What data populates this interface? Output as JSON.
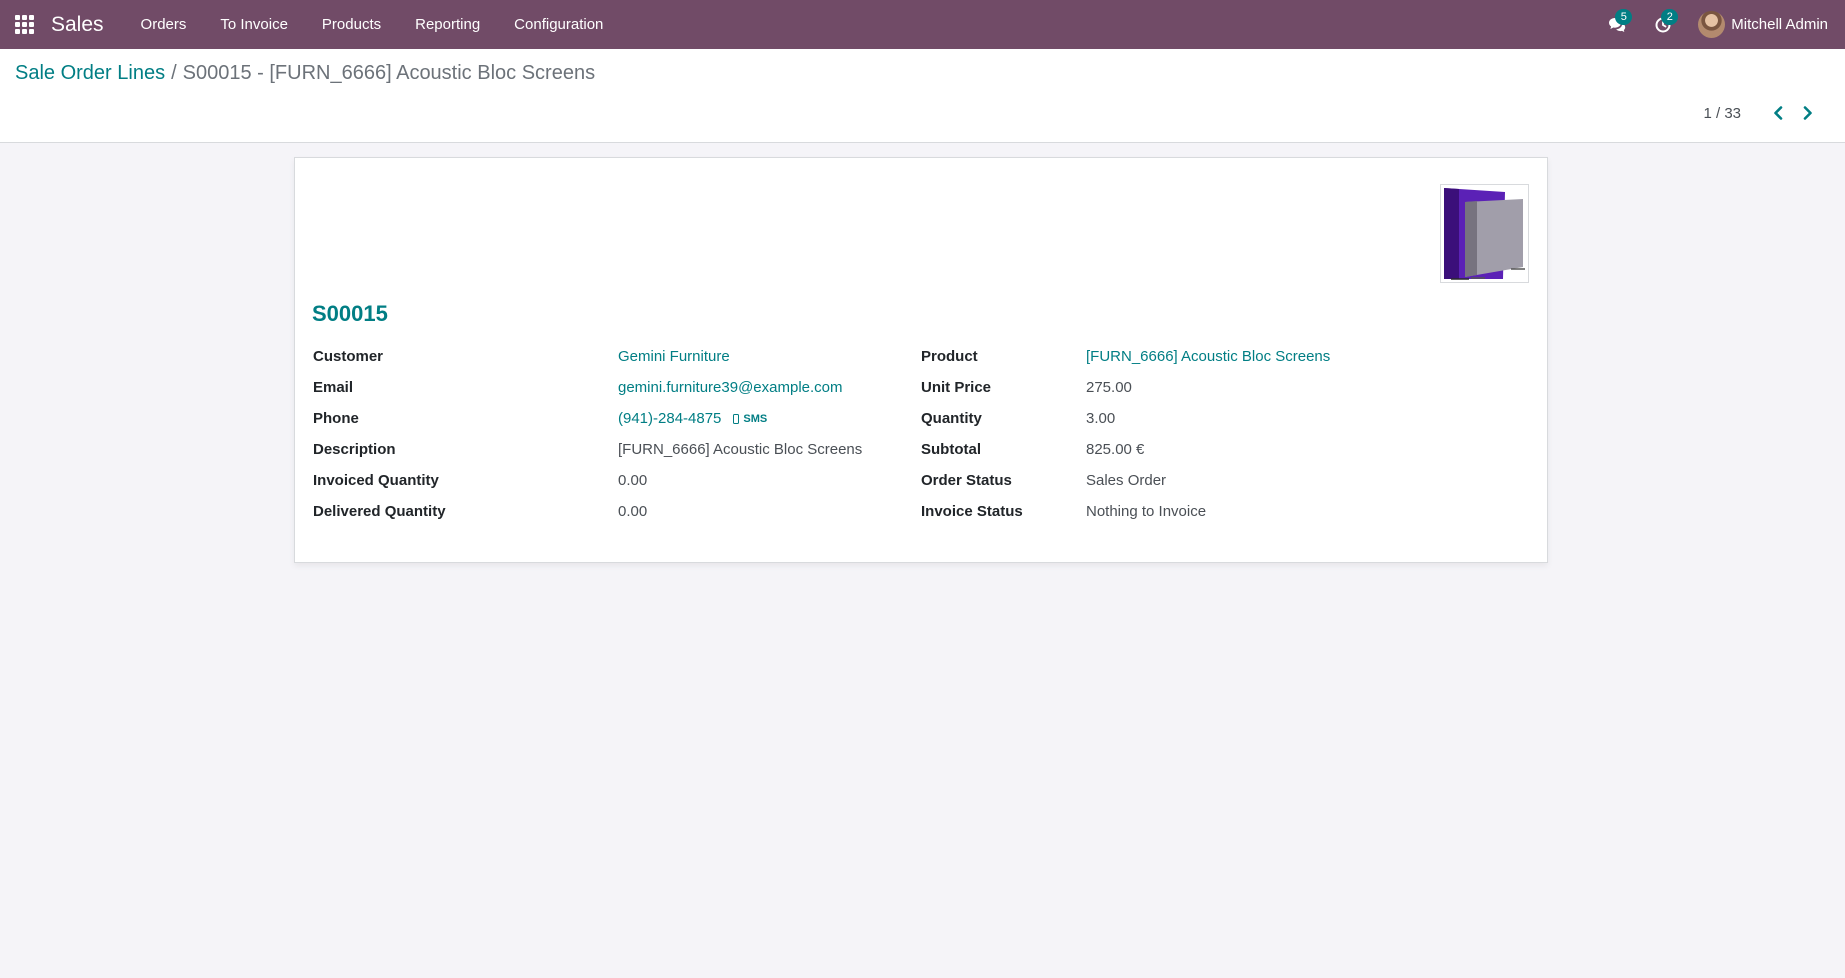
{
  "navbar": {
    "app_name": "Sales",
    "menu": [
      "Orders",
      "To Invoice",
      "Products",
      "Reporting",
      "Configuration"
    ],
    "messages_count": "5",
    "activities_count": "2",
    "user_name": "Mitchell Admin"
  },
  "breadcrumb": {
    "parent": "Sale Order Lines",
    "separator": "/",
    "current": "S00015 - [FURN_6666] Acoustic Bloc Screens"
  },
  "pager": {
    "value": "1 / 33"
  },
  "record": {
    "title": "S00015",
    "left_fields": [
      {
        "label": "Customer",
        "value": "Gemini Furniture"
      },
      {
        "label": "Email",
        "value": "gemini.furniture39@example.com"
      },
      {
        "label": "Phone",
        "value": "(941)-284-4875",
        "sms_label": "SMS"
      },
      {
        "label": "Description",
        "value": "[FURN_6666] Acoustic Bloc Screens"
      },
      {
        "label": "Invoiced Quantity",
        "value": "0.00"
      },
      {
        "label": "Delivered Quantity",
        "value": "0.00"
      }
    ],
    "right_fields": [
      {
        "label": "Product",
        "value": "[FURN_6666] Acoustic Bloc Screens"
      },
      {
        "label": "Unit Price",
        "value": "275.00"
      },
      {
        "label": "Quantity",
        "value": "3.00"
      },
      {
        "label": "Subtotal",
        "value": "825.00 €"
      },
      {
        "label": "Order Status",
        "value": "Sales Order"
      },
      {
        "label": "Invoice Status",
        "value": "Nothing to Invoice"
      }
    ]
  },
  "colors": {
    "navbar": "#714b67",
    "link": "#017e84",
    "background": "#f5f4f8"
  }
}
